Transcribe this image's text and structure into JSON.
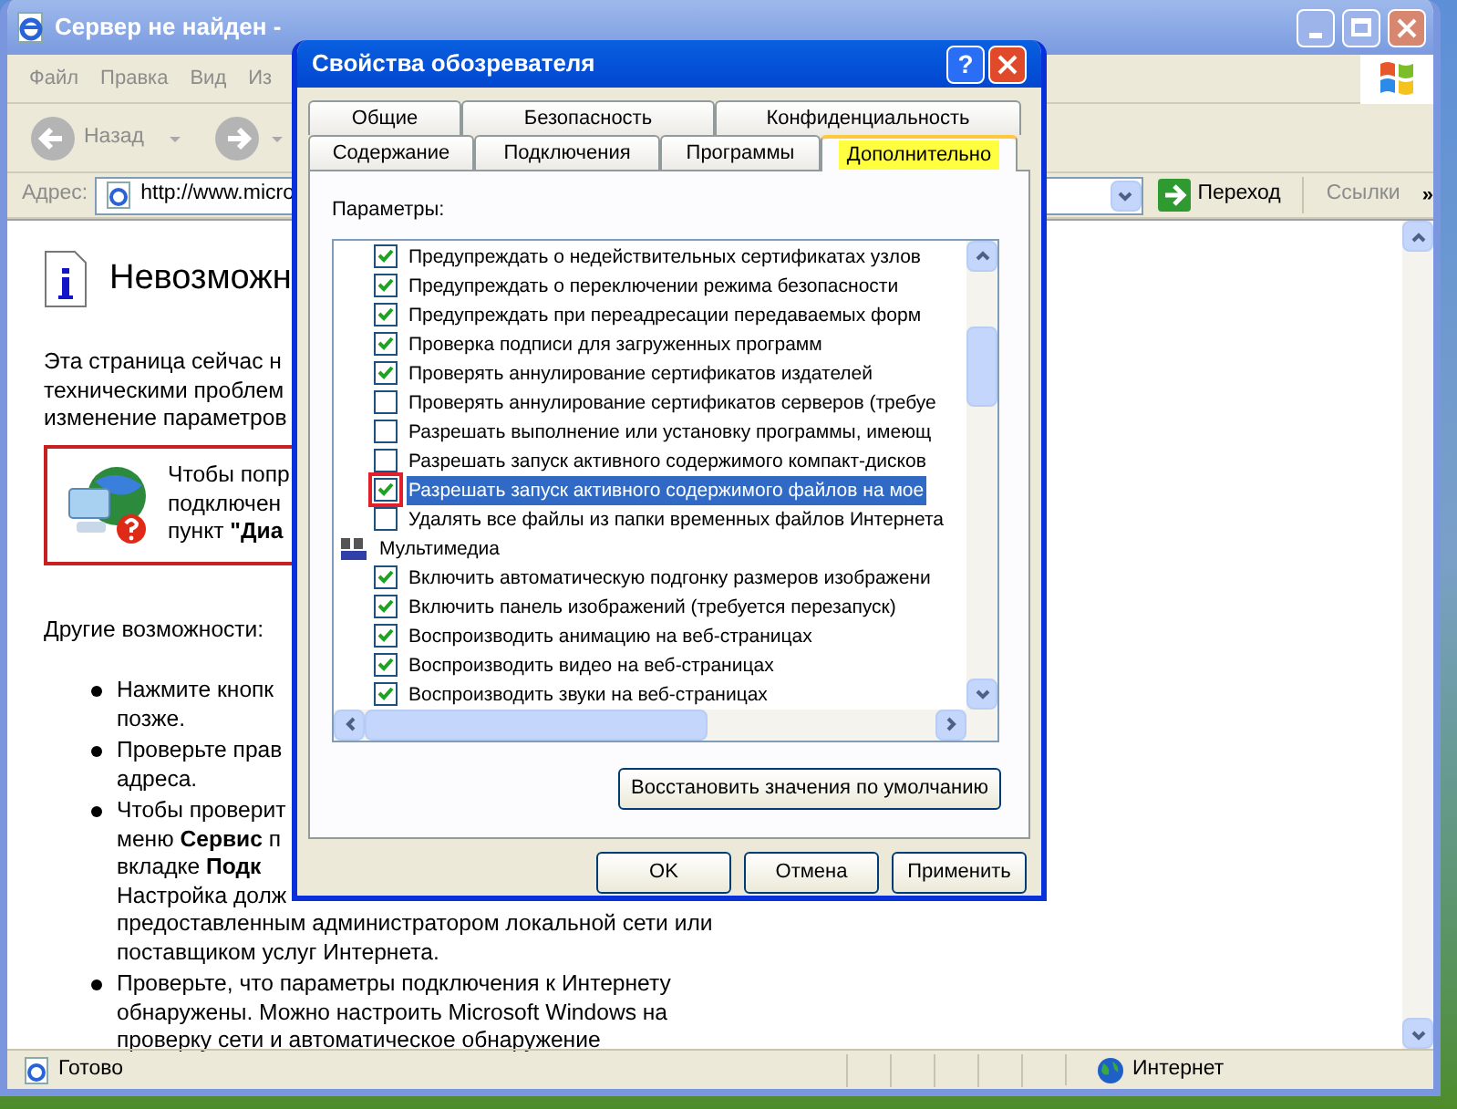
{
  "browser": {
    "title": "Сервер не найден -",
    "menu": [
      "Файл",
      "Правка",
      "Вид",
      "Из"
    ],
    "back_label": "Назад",
    "address_label": "Адрес:",
    "address": "http://www.micro",
    "go_label": "Переход",
    "links_label": "Ссылки",
    "links_chevron": "»",
    "heading": "Невозможн",
    "intro": [
      "Эта страница сейчас н",
      "техническими проблем",
      "изменение параметров"
    ],
    "notice": [
      "Чтобы попр",
      "подключен",
      "пункт **\"Диа**"
    ],
    "other_heading": "Другие возможности:",
    "bullets": [
      {
        "lines": [
          "Нажмите кнопк",
          "позже."
        ]
      },
      {
        "lines": [
          "Проверьте прав",
          "адреса."
        ]
      },
      {
        "lines": [
          "Чтобы проверит",
          "меню **Сервис** п",
          "вкладке **Подк**",
          "Настройка долж",
          "предоставленным администратором локальной сети или",
          "поставщиком услуг Интернета."
        ]
      },
      {
        "lines": [
          "Проверьте, что параметры подключения к Интернету",
          "обнаружены. Можно настроить Microsoft Windows на",
          "проверку сети и автоматическое обнаружение"
        ]
      }
    ],
    "status": "Готово",
    "zone": "Интернет"
  },
  "dialog": {
    "title": "Свойства обозревателя",
    "help": "?",
    "tab_rows": [
      {
        "tabs": [
          {
            "label": "Общие",
            "selected": false,
            "highlighted": false
          },
          {
            "label": "Безопасность",
            "selected": false,
            "highlighted": false
          },
          {
            "label": "Конфиденциальность",
            "selected": false,
            "highlighted": false
          }
        ]
      },
      {
        "tabs": [
          {
            "label": "Содержание",
            "selected": false,
            "highlighted": false
          },
          {
            "label": "Подключения",
            "selected": false,
            "highlighted": false
          },
          {
            "label": "Программы",
            "selected": false,
            "highlighted": false
          },
          {
            "label": "Дополнительно",
            "selected": true,
            "highlighted": true
          }
        ]
      }
    ],
    "settings_label": "Параметры:",
    "items": [
      {
        "kind": "checkbox",
        "label": "Предупреждать о недействительных сертификатах узлов",
        "checked": true,
        "selected": false,
        "marked": false
      },
      {
        "kind": "checkbox",
        "label": "Предупреждать о переключении режима безопасности",
        "checked": true,
        "selected": false,
        "marked": false
      },
      {
        "kind": "checkbox",
        "label": "Предупреждать при переадресации передаваемых форм",
        "checked": true,
        "selected": false,
        "marked": false
      },
      {
        "kind": "checkbox",
        "label": "Проверка подписи для загруженных программ",
        "checked": true,
        "selected": false,
        "marked": false
      },
      {
        "kind": "checkbox",
        "label": "Проверять аннулирование сертификатов издателей",
        "checked": true,
        "selected": false,
        "marked": false
      },
      {
        "kind": "checkbox",
        "label": "Проверять аннулирование сертификатов серверов (требуе",
        "checked": false,
        "selected": false,
        "marked": false
      },
      {
        "kind": "checkbox",
        "label": "Разрешать выполнение или установку программы, имеющ",
        "checked": false,
        "selected": false,
        "marked": false
      },
      {
        "kind": "checkbox",
        "label": "Разрешать запуск активного содержимого компакт-дисков",
        "checked": false,
        "selected": false,
        "marked": false
      },
      {
        "kind": "checkbox",
        "label": "Разрешать запуск активного содержимого файлов на мое",
        "checked": true,
        "selected": true,
        "marked": true
      },
      {
        "kind": "checkbox",
        "label": "Удалять все файлы из папки временных файлов Интернета",
        "checked": false,
        "selected": false,
        "marked": false
      },
      {
        "kind": "group",
        "label": "Мультимедиа"
      },
      {
        "kind": "checkbox",
        "label": "Включить автоматическую подгонку размеров изображени",
        "checked": true,
        "selected": false,
        "marked": false
      },
      {
        "kind": "checkbox",
        "label": "Включить панель изображений (требуется перезапуск)",
        "checked": true,
        "selected": false,
        "marked": false
      },
      {
        "kind": "checkbox",
        "label": "Воспроизводить анимацию на веб-страницах",
        "checked": true,
        "selected": false,
        "marked": false
      },
      {
        "kind": "checkbox",
        "label": "Воспроизводить видео на веб-страницах",
        "checked": true,
        "selected": false,
        "marked": false
      },
      {
        "kind": "checkbox",
        "label": "Воспроизводить звуки на веб-страницах",
        "checked": true,
        "selected": false,
        "marked": false
      }
    ],
    "restore_button": "Восстановить значения по умолчанию",
    "buttons": [
      "OK",
      "Отмена",
      "Применить"
    ]
  }
}
